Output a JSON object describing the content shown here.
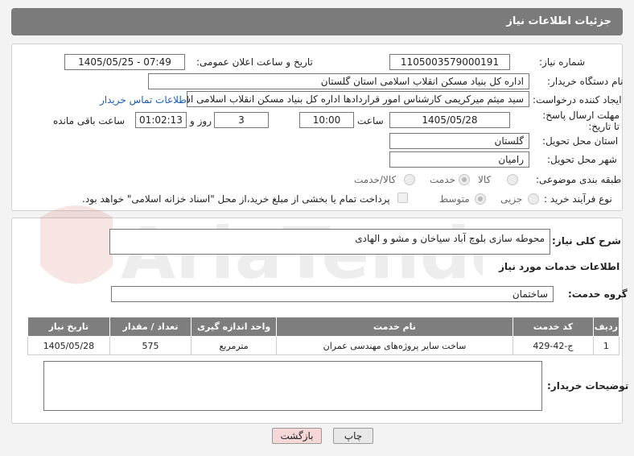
{
  "header": {
    "title": "جزئیات اطلاعات نیاز"
  },
  "form": {
    "need_number_label": "شماره نیاز:",
    "need_number": "1105003579000191",
    "announce_label": "تاریخ و ساعت اعلان عمومی:",
    "announce_value": "1405/05/25 - 07:49",
    "buyer_org_label": "نام دستگاه خریدار:",
    "buyer_org": "اداره کل بنیاد مسکن انقلاب اسلامی استان گلستان",
    "creator_label": "ایجاد کننده درخواست:",
    "creator": "سید میثم میرکریمی کارشناس امور قراردادها اداره کل بنیاد مسکن انقلاب اسلامی استان",
    "contact_link": "اطلاعات تماس خریدار",
    "deadline_label": "مهلت ارسال پاسخ: تا تاریخ:",
    "deadline_date": "1405/05/28",
    "time_label": "ساعت",
    "deadline_time": "10:00",
    "days_value": "3",
    "days_label": "روز و",
    "remaining_time": "01:02:13",
    "remaining_label": "ساعت باقی مانده",
    "province_label": "استان محل تحویل:",
    "province": "گلستان",
    "city_label": "شهر محل تحویل:",
    "city": "رامیان",
    "category_label": "طبقه بندی موضوعی:",
    "category_goods": "کالا",
    "category_service": "خدمت",
    "category_both": "کالا/خدمت",
    "process_label": "نوع فرآیند خرید :",
    "process_minor": "جزیی",
    "process_medium": "متوسط",
    "treasury_note": "پرداخت تمام یا بخشی از مبلغ خرید،از محل \"اسناد خزانه اسلامی\" خواهد بود."
  },
  "details": {
    "summary_label": "شرح کلی نیاز:",
    "summary": "محوطه سازی بلوچ آباد سیاخان و مشو و الهادی",
    "services_title": "اطلاعات خدمات مورد نیاز",
    "group_label": "گروه خدمت:",
    "group_value": "ساختمان",
    "table": {
      "headers": [
        "ردیف",
        "کد خدمت",
        "نام خدمت",
        "واحد اندازه گیری",
        "تعداد / مقدار",
        "تاریخ نیاز"
      ],
      "rows": [
        [
          "1",
          "ج-42-429",
          "ساخت سایر پروژه‌های مهندسی عمران",
          "مترمربع",
          "575",
          "1405/05/28"
        ]
      ]
    },
    "buyer_notes_label": "توضیحات خریدار:"
  },
  "buttons": {
    "print": "چاپ",
    "back": "بازگشت"
  },
  "watermark": "AriaTender.net"
}
